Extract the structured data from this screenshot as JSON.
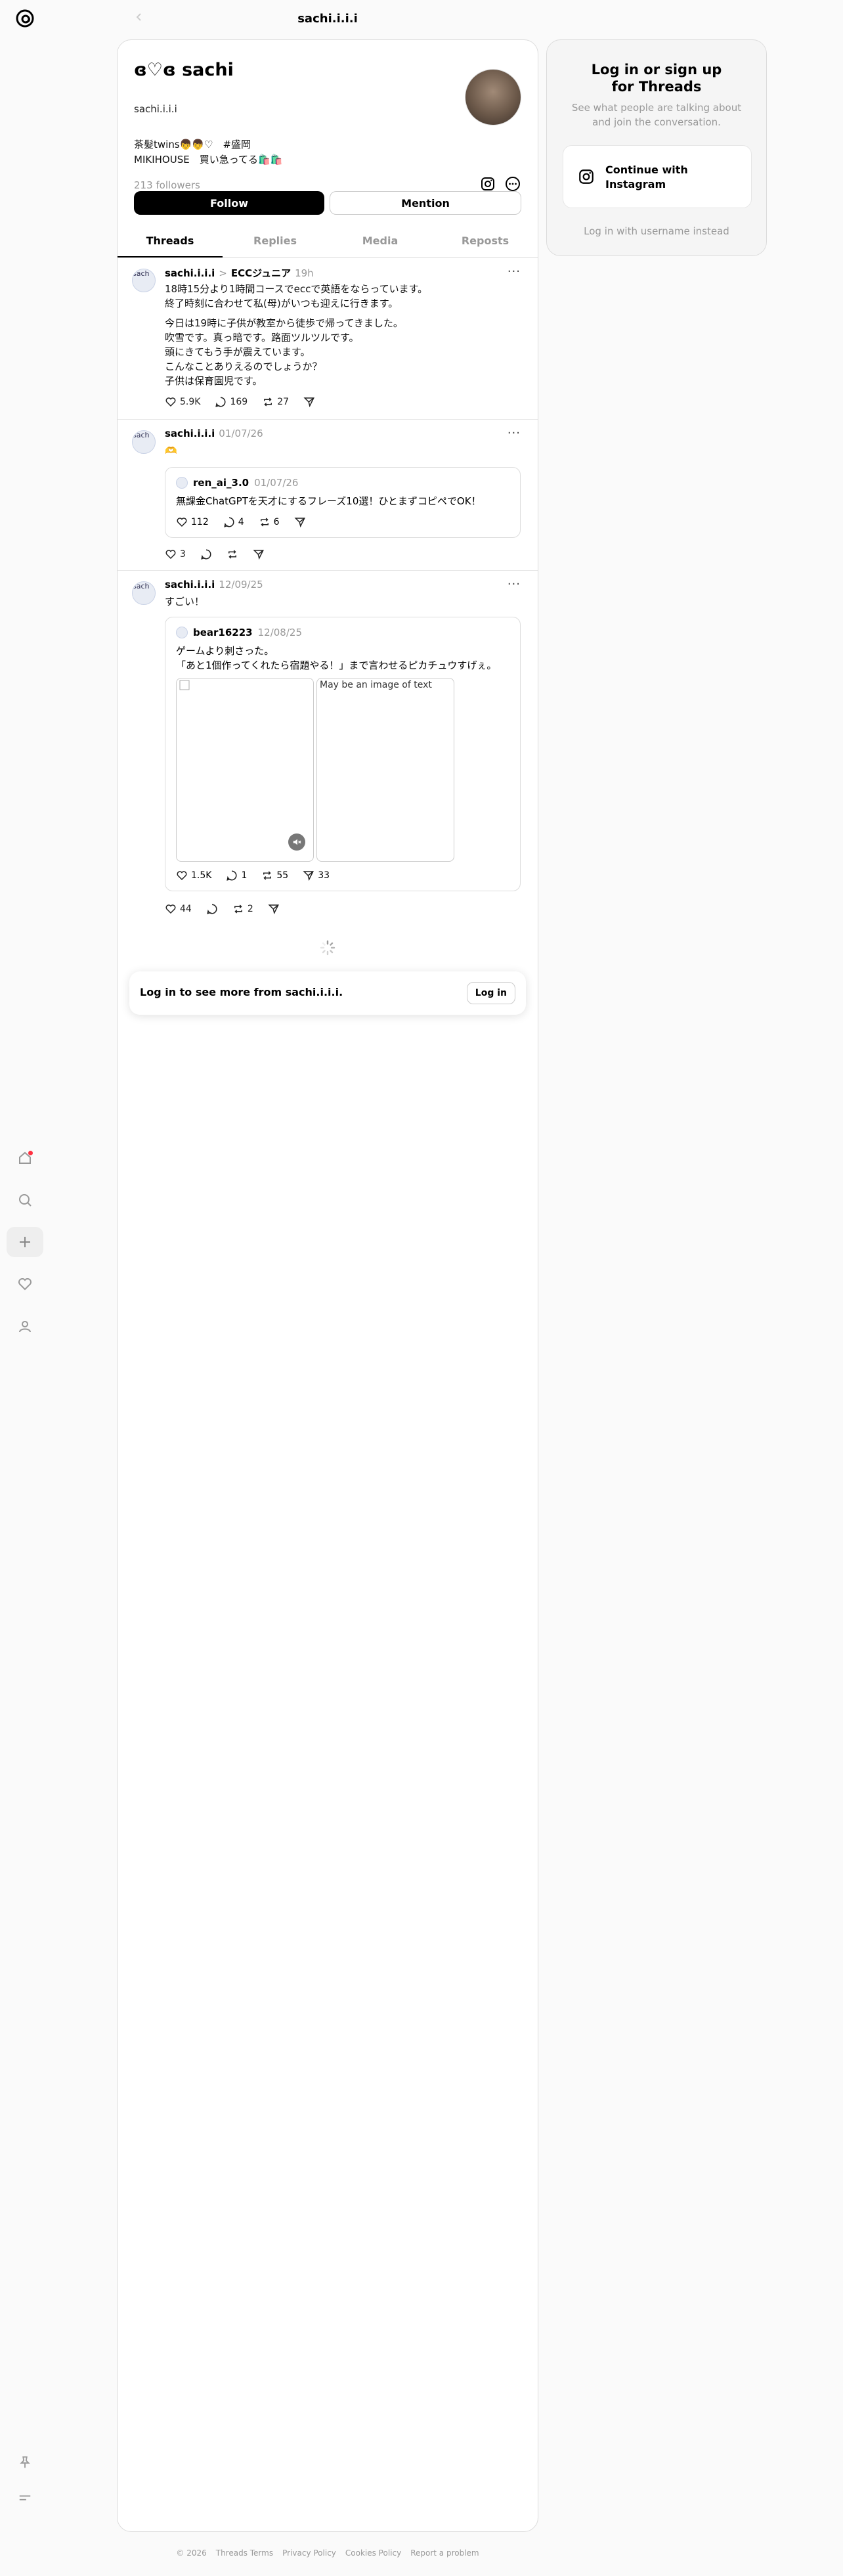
{
  "header": {
    "title": "sachi.i.i.i"
  },
  "nav": {
    "items": [
      "home",
      "search",
      "create",
      "activity",
      "profile",
      "pin",
      "menu"
    ]
  },
  "profile": {
    "display_name": "ɞ♡ɞ sachi",
    "handle": "sachi.i.i.i",
    "bio_line1": "茶髪twins👦👦♡　#盛岡",
    "bio_line2": "MIKIHOUSE　買い急ってる🛍️🛍️",
    "followers": "213 followers",
    "follow_label": "Follow",
    "mention_label": "Mention"
  },
  "tabs": [
    "Threads",
    "Replies",
    "Media",
    "Reposts"
  ],
  "posts": [
    {
      "avatar_alt": "sach",
      "username": "sachi.i.i.i",
      "sep": ">",
      "tag": "ECCジュニア",
      "time": "19h",
      "more": "···",
      "text": [
        "18時15分より1時間コースでeccで英語をならっています。",
        "終了時刻に合わせて私(母)がいつも迎えに行きます。",
        "",
        "今日は19時に子供が教室から徒歩で帰ってきました。",
        "吹雪です。真っ暗です。路面ツルツルです。",
        "頭にきてもう手が震えています。",
        "こんなことありえるのでしょうか？",
        "子供は保育園児です。"
      ],
      "likes": "5.9K",
      "replies": "169",
      "reposts": "27"
    },
    {
      "avatar_alt": "sach",
      "username": "sachi.i.i.i",
      "time": "01/07/26",
      "more": "···",
      "text": [
        "🫶"
      ],
      "quote": {
        "username": "ren_ai_3.0",
        "time": "01/07/26",
        "text": "無課金ChatGPTを天才にするフレーズ10選！ひとまずコピペでOK！",
        "likes": "112",
        "replies": "4",
        "reposts": "6"
      },
      "likes": "3",
      "replies": "",
      "reposts": ""
    },
    {
      "avatar_alt": "sach",
      "username": "sachi.i.i.i",
      "time": "12/09/25",
      "more": "···",
      "text": [
        "すごい！"
      ],
      "quote": {
        "username": "bear16223",
        "time": "12/08/25",
        "text_line1": "ゲームより刺さった。",
        "text_line2": "「あと1個作ってくれたら宿題やる！」まで言わせるピカチュウすげぇ。",
        "image2_alt": "May be an image of text",
        "likes": "1.5K",
        "replies": "1",
        "reposts": "55",
        "shares": "33"
      },
      "likes": "44",
      "replies": "",
      "reposts": "2"
    }
  ],
  "login_prompt": {
    "text": "Log in to see more from sachi.i.i.i.",
    "button": "Log in"
  },
  "sidebar": {
    "title_line1": "Log in or sign up",
    "title_line2": "for Threads",
    "subtitle": "See what people are talking about and join the conversation.",
    "instagram_line1": "Continue with",
    "instagram_line2": "Instagram",
    "username_link": "Log in with username instead"
  },
  "footer": [
    "© 2026",
    "Threads Terms",
    "Privacy Policy",
    "Cookies Policy",
    "Report a problem"
  ]
}
